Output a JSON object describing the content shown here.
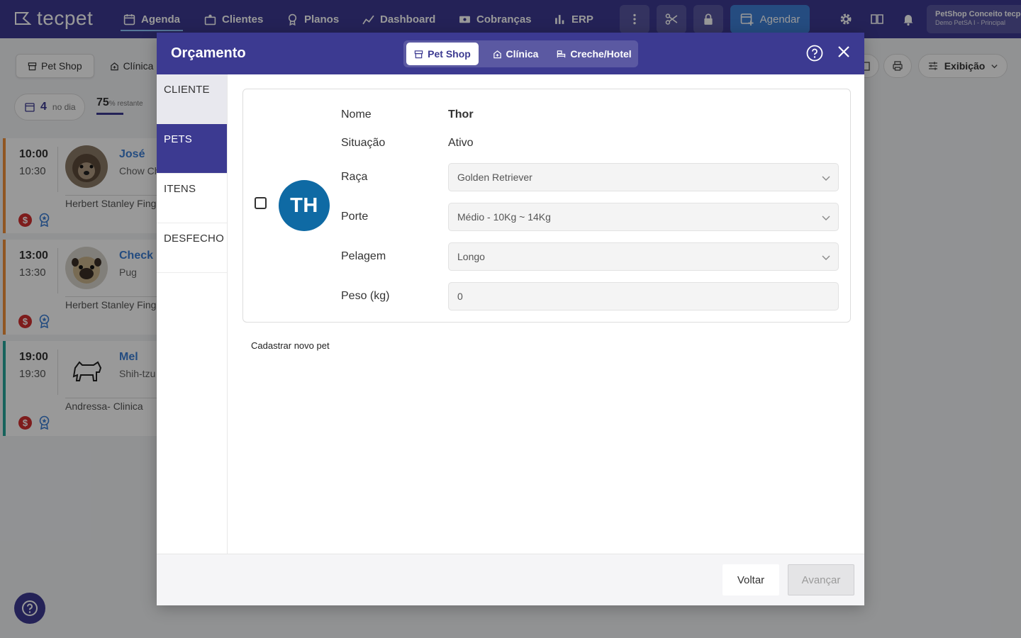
{
  "nav": {
    "logo": "tecpet",
    "items": [
      {
        "label": "Agenda",
        "icon": "calendar-icon"
      },
      {
        "label": "Clientes",
        "icon": "clients-icon"
      },
      {
        "label": "Planos",
        "icon": "plans-icon"
      },
      {
        "label": "Dashboard",
        "icon": "chart-line-icon"
      },
      {
        "label": "Cobranças",
        "icon": "money-icon"
      },
      {
        "label": "ERP",
        "icon": "bar-chart-icon"
      }
    ],
    "agendar_label": "Agendar",
    "company_name": "PetShop Conceito tecpet",
    "company_sub": "Demo PetSA I - Principal"
  },
  "background": {
    "tabs": [
      {
        "label": "Pet Shop",
        "selected": true
      },
      {
        "label": "Clínica",
        "selected": false
      }
    ],
    "day_count": "4",
    "day_label": "no dia",
    "remaining_value": "75",
    "remaining_unit": "%",
    "remaining_label": "restante",
    "exibicao_label": "Exibição",
    "appointments": [
      {
        "start": "10:00",
        "end": "10:30",
        "pet": "José",
        "breed": "Chow Chow",
        "staff": "Herbert Stanley Finger"
      },
      {
        "start": "13:00",
        "end": "13:30",
        "pet": "Check",
        "breed": "Pug",
        "staff": "Herbert Stanley Finger"
      },
      {
        "start": "19:00",
        "end": "19:30",
        "pet": "Mel",
        "breed": "Shih-tzu",
        "staff": "Andressa- Clinica"
      }
    ],
    "dollar_symbol": "$"
  },
  "modal": {
    "title": "Orçamento",
    "segments": [
      {
        "label": "Pet Shop",
        "selected": true
      },
      {
        "label": "Clínica",
        "selected": false
      },
      {
        "label": "Creche/Hotel",
        "selected": false
      }
    ],
    "steps": [
      "CLIENTE",
      "PETS",
      "ITENS",
      "DESFECHO"
    ],
    "active_step": "PETS",
    "pet": {
      "initials": "TH",
      "fields": {
        "nome_label": "Nome",
        "nome_value": "Thor",
        "situacao_label": "Situação",
        "situacao_value": "Ativo",
        "raca_label": "Raça",
        "raca_value": "Golden Retriever",
        "porte_label": "Porte",
        "porte_value": "Médio - 10Kg ~ 14Kg",
        "pelagem_label": "Pelagem",
        "pelagem_value": "Longo",
        "peso_label": "Peso (kg)",
        "peso_value": "0"
      },
      "selected": false
    },
    "new_pet_link": "Cadastrar novo pet",
    "voltar_label": "Voltar",
    "avancar_label": "Avançar"
  },
  "colors": {
    "brand": "#3c3a91",
    "accent": "#3f7fd6",
    "avatar": "#0f6aa4",
    "dollar_badge": "#d32f2f"
  }
}
